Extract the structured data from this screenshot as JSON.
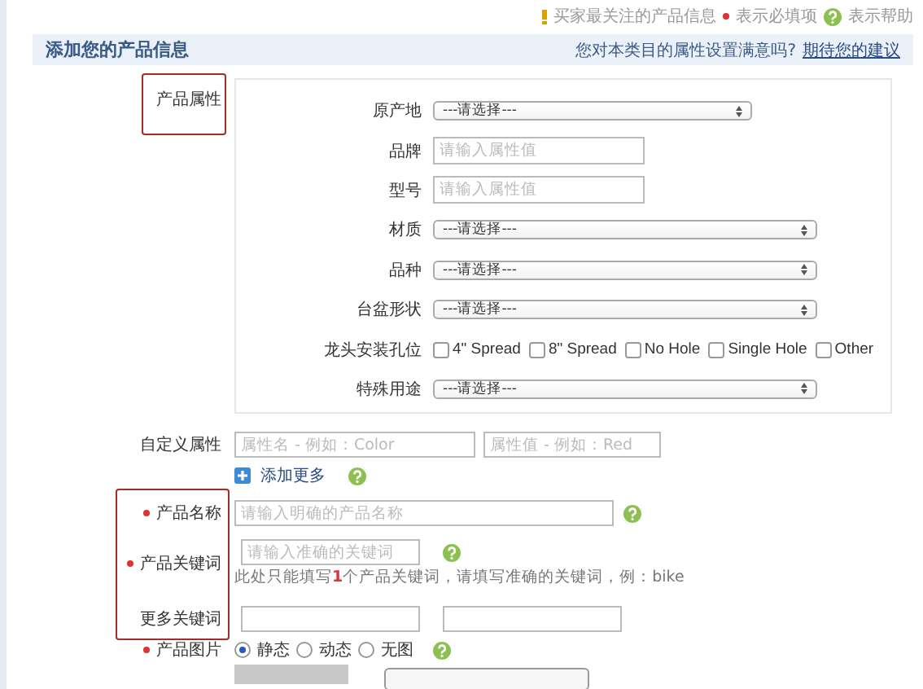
{
  "legend": [
    {
      "kind": "note",
      "text": "买家最关注的产品信息"
    },
    {
      "kind": "required",
      "text": "表示必填项"
    },
    {
      "kind": "help",
      "text": "表示帮助"
    }
  ],
  "header": {
    "title": "添加您的产品信息",
    "question": "您对本类目的属性设置满意吗?",
    "link": "期待您的建议"
  },
  "form_rows": [
    {
      "kind": "attributes",
      "label": "产品属性",
      "required": false,
      "highlighted": true,
      "attributes": [
        {
          "kind": "select",
          "label": "原产地",
          "value": "---请选择---",
          "wide": false
        },
        {
          "kind": "text",
          "label": "品牌",
          "placeholder": "请输入属性值"
        },
        {
          "kind": "text",
          "label": "型号",
          "placeholder": "请输入属性值"
        },
        {
          "kind": "select",
          "label": "材质",
          "value": "---请选择---",
          "wide": true
        },
        {
          "kind": "select",
          "label": "品种",
          "value": "---请选择---",
          "wide": true
        },
        {
          "kind": "select",
          "label": "台盆形状",
          "value": "---请选择---",
          "wide": true
        },
        {
          "kind": "checkboxes",
          "label": "龙头安装孔位",
          "options": [
            {
              "label": "4\" Spread",
              "checked": false
            },
            {
              "label": "8\" Spread",
              "checked": false
            },
            {
              "label": "No Hole",
              "checked": false
            },
            {
              "label": "Single Hole",
              "checked": false
            },
            {
              "label": "Other",
              "checked": false
            }
          ]
        },
        {
          "kind": "select",
          "label": "特殊用途",
          "value": "---请选择---",
          "wide": true
        }
      ]
    },
    {
      "kind": "pair",
      "label": "自定义属性",
      "required": false,
      "highlighted": false,
      "fields": [
        {
          "kind": "text",
          "placeholder": "属性名 - 例如：Color"
        },
        {
          "kind": "text",
          "placeholder": "属性值 - 例如：Red"
        }
      ]
    },
    {
      "kind": "add_more",
      "link": "添加更多",
      "help": true
    },
    {
      "kind": "text",
      "label": "产品名称",
      "required": true,
      "highlighted": true,
      "placeholder": "请输入明确的产品名称",
      "help": true
    },
    {
      "kind": "keyword",
      "label": "产品关键词",
      "required": true,
      "highlighted": true,
      "placeholder": "请输入准确的关键词",
      "help": true,
      "hint": "此处只能填写**1**个产品关键词，请填写准确的关键词，例：bike"
    },
    {
      "kind": "pair",
      "label": "更多关键词",
      "required": false,
      "highlighted": true,
      "fields": [
        {
          "kind": "blank"
        },
        {
          "kind": "blank"
        }
      ]
    },
    {
      "kind": "radios",
      "label": "产品图片",
      "required": true,
      "highlighted": false,
      "help": true,
      "options": [
        {
          "label": "静态",
          "selected": true
        },
        {
          "label": "动态",
          "selected": false
        },
        {
          "label": "无图",
          "selected": false
        }
      ]
    },
    {
      "kind": "upload"
    }
  ]
}
